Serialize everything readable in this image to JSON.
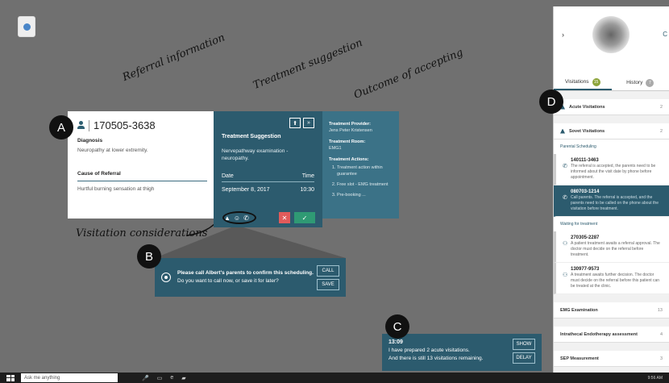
{
  "annotations": {
    "referral": "Referral information",
    "treatment": "Treatment suggestion",
    "outcome": "Outcome of accepting",
    "visitation": "Visitation considerations",
    "markers": [
      "A",
      "B",
      "C",
      "D"
    ]
  },
  "referral": {
    "id": "170505-3638",
    "diagnosis_label": "Diagnosis",
    "diagnosis": "Neuropathy at lower extremity.",
    "cause_label": "Cause of Referral",
    "cause": "Hurtful burning sensation at thigh"
  },
  "treatment": {
    "title": "Treatment Suggestion",
    "text": "Nervepathway examination - neuropathy.",
    "date_label": "Date",
    "time_label": "Time",
    "date": "September 8, 2017",
    "time": "10:30",
    "btn_pin": "⬆",
    "btn_next": "»",
    "btn_reject": "✕",
    "btn_accept": "✓"
  },
  "outcome": {
    "provider_label": "Treatment Provider:",
    "provider": "Jens Peter Kristensen",
    "room_label": "Treatment Room:",
    "room": "EMG1",
    "actions_label": "Treatment Actions:",
    "actions": [
      "Treatment action within guarantee",
      "Free slot - EMG treatment",
      "Pre-booking ..."
    ]
  },
  "notif_b": {
    "title": "Please call Albert's parents to confirm this scheduling.",
    "text": "Do you want to call now, or save it for later?",
    "btn1": "CALL",
    "btn2": "SAVE"
  },
  "notif_c": {
    "time": "13:09",
    "line1": "I have prepared 2 acute visitations.",
    "line2": "And there is still 13 visitations remaining.",
    "btn1": "SHOW",
    "btn2": "DELAY"
  },
  "panel": {
    "tab1": "Visitations",
    "tab1_count": "15",
    "tab2": "History",
    "tab2_count": "7",
    "sections": [
      {
        "label": "Acute Visitations",
        "count": "2"
      },
      {
        "label": "Sovet Visitations",
        "count": "2"
      }
    ],
    "sub1": "Parental Scheduling",
    "items1": [
      {
        "id": "140111-3463",
        "text": "The referral is accepted, the parents need to be informed about the visit date by phone before appointment."
      },
      {
        "id": "080703-1214",
        "text": "Call parents. The referral is accepted, and the parents need to be called on the phone about the visitation before treatment."
      }
    ],
    "sub2": "Waiting for treatment",
    "items2": [
      {
        "id": "270305-2287",
        "text": "A patient treatment awaits a referral approval. The doctor must decide on the referral before treatment."
      },
      {
        "id": "130977-9573",
        "text": "A treatment awaits further decision. The doctor must decide on the referral before this patient can be treated at the clinic."
      }
    ],
    "bottom": [
      {
        "label": "EMG Examination",
        "count": "13"
      },
      {
        "label": "Intrathecal Endotherapy assessment",
        "count": "4"
      },
      {
        "label": "SEP Measurement",
        "count": "3"
      }
    ]
  },
  "taskbar": {
    "search": "Ask me anything",
    "clock": "9:56 AM"
  }
}
